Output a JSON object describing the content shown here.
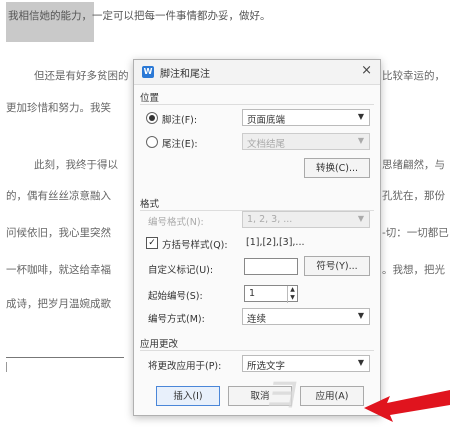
{
  "document": {
    "lines": [
      {
        "text": "我相信她的能力，一定可以把每一件事情都办妥，做好。"
      },
      {
        "text": "但还是有好多贫困的"
      },
      {
        "text": "更加珍惜和努力。我笑"
      },
      {
        "text": "此刻，我终于得以"
      },
      {
        "text": "的，偶有丝丝凉意融入"
      },
      {
        "text": "问候依旧，我心里突然"
      },
      {
        "text": "一杯咖啡，就这给幸福"
      },
      {
        "text": "成诗，把岁月温婉成歌"
      }
    ],
    "right_fragments": [
      {
        "text": "比较幸运的，"
      },
      {
        "text": "思绪翩然，与"
      },
      {
        "text": "孔犹在，那份"
      },
      {
        "text": "-切：一切都已"
      },
      {
        "text": "。我想，把光"
      }
    ]
  },
  "dialog": {
    "title": "脚注和尾注",
    "app_icon": "W",
    "close_glyph": "×",
    "position": {
      "heading": "位置",
      "footnote_label": "脚注(F):",
      "footnote_value": "页面底端",
      "footnote_selected": true,
      "endnote_label": "尾注(E):",
      "endnote_value": "文档结尾",
      "convert_button": "转换(C)..."
    },
    "format": {
      "heading": "格式",
      "number_format_label": "编号格式(N):",
      "number_format_value": "1, 2, 3, ...",
      "bracket_label": "方括号样式(Q):",
      "bracket_preview": "[1],[2],[3],...",
      "bracket_checked": true,
      "custom_mark_label": "自定义标记(U):",
      "custom_mark_value": "",
      "symbol_button": "符号(Y)...",
      "start_label": "起始编号(S):",
      "start_value": "1",
      "numbering_label": "编号方式(M):",
      "numbering_value": "连续"
    },
    "apply": {
      "heading": "应用更改",
      "apply_to_label": "将更改应用于(P):",
      "apply_to_value": "所选文字"
    },
    "buttons": {
      "insert": "插入(I)",
      "cancel": "取消",
      "apply": "应用(A)"
    }
  },
  "icons": {
    "caret": "▼",
    "spin_up": "▲",
    "spin_down": "▼",
    "check": "✓"
  },
  "colors": {
    "arrow": "#e0141e",
    "accent": "#2b79d6"
  }
}
